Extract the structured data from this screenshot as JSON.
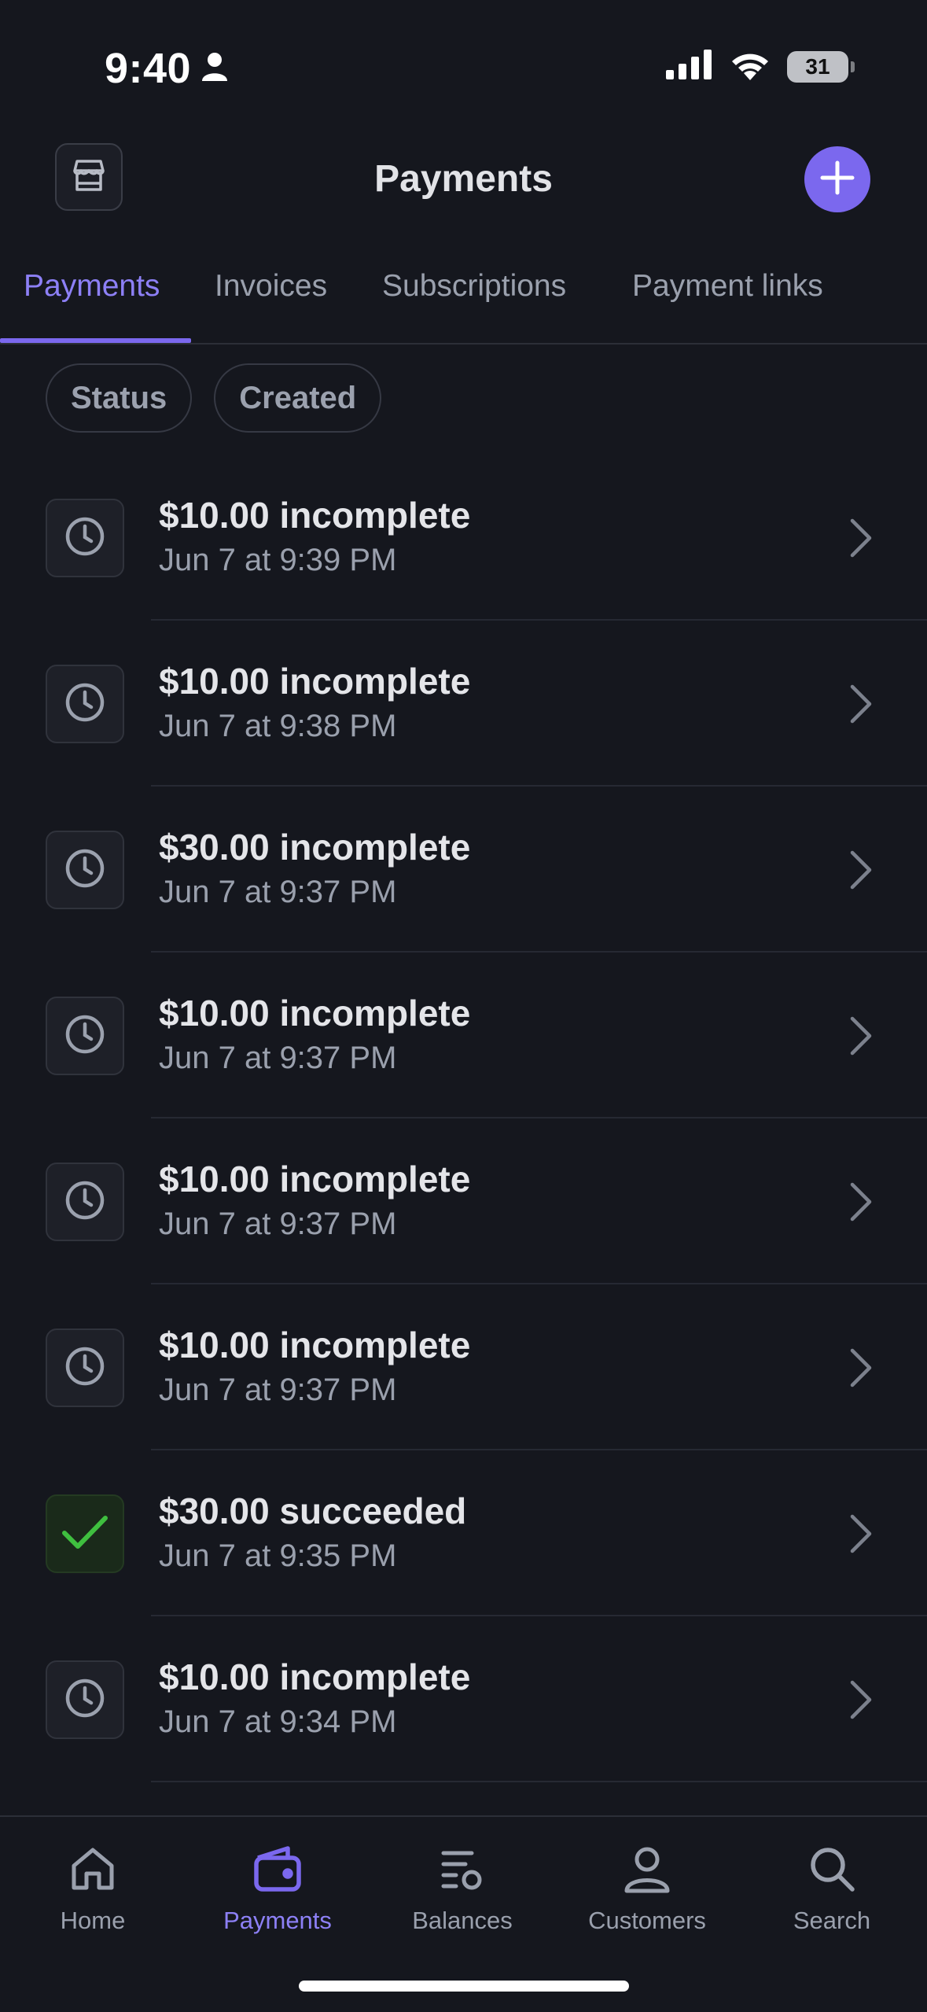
{
  "status_bar": {
    "time": "9:40",
    "battery": "31"
  },
  "header": {
    "title": "Payments"
  },
  "tabs": [
    {
      "label": "Payments",
      "active": true
    },
    {
      "label": "Invoices",
      "active": false
    },
    {
      "label": "Subscriptions",
      "active": false
    },
    {
      "label": "Payment links",
      "active": false
    }
  ],
  "filters": [
    {
      "label": "Status"
    },
    {
      "label": "Created"
    }
  ],
  "payments": [
    {
      "title": "$10.00 incomplete",
      "subtitle": "Jun 7 at 9:39 PM",
      "status_icon": "clock-icon"
    },
    {
      "title": "$10.00 incomplete",
      "subtitle": "Jun 7 at 9:38 PM",
      "status_icon": "clock-icon"
    },
    {
      "title": "$30.00 incomplete",
      "subtitle": "Jun 7 at 9:37 PM",
      "status_icon": "clock-icon"
    },
    {
      "title": "$10.00 incomplete",
      "subtitle": "Jun 7 at 9:37 PM",
      "status_icon": "clock-icon"
    },
    {
      "title": "$10.00 incomplete",
      "subtitle": "Jun 7 at 9:37 PM",
      "status_icon": "clock-icon"
    },
    {
      "title": "$10.00 incomplete",
      "subtitle": "Jun 7 at 9:37 PM",
      "status_icon": "clock-icon"
    },
    {
      "title": "$30.00 succeeded",
      "subtitle": "Jun 7 at 9:35 PM",
      "status_icon": "checkmark-icon"
    },
    {
      "title": "$10.00 incomplete",
      "subtitle": "Jun 7 at 9:34 PM",
      "status_icon": "clock-icon"
    }
  ],
  "bottom_nav": [
    {
      "label": "Home",
      "icon": "home-icon",
      "active": false
    },
    {
      "label": "Payments",
      "icon": "wallet-icon",
      "active": true
    },
    {
      "label": "Balances",
      "icon": "balances-icon",
      "active": false
    },
    {
      "label": "Customers",
      "icon": "person-icon",
      "active": false
    },
    {
      "label": "Search",
      "icon": "search-icon",
      "active": false
    }
  ],
  "colors": {
    "background": "#15171e",
    "accent": "#7b68ee",
    "success": "#3fbf3f",
    "muted_text": "#9aa0ad"
  }
}
